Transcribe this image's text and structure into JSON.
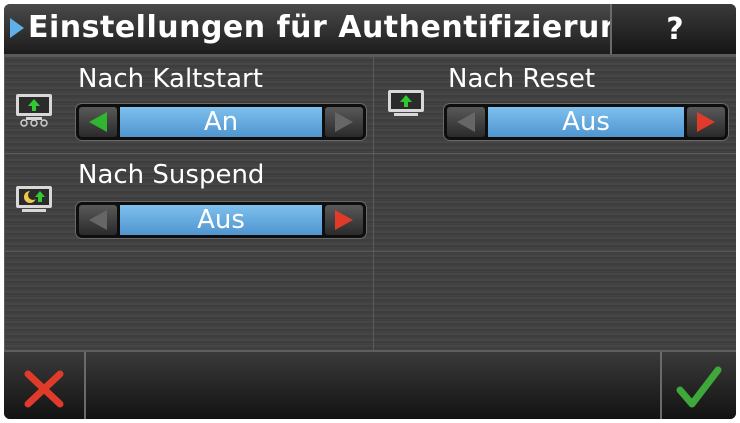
{
  "header": {
    "title": "Einstellungen für Authentifizierung",
    "help_label": "?"
  },
  "settings": [
    {
      "label": "Nach Kaltstart",
      "value": "An",
      "icon": "monitor-power-on-icon",
      "left_arrow_color": "#2fb52f",
      "right_arrow_color": "#666666"
    },
    {
      "label": "Nach Reset",
      "value": "Aus",
      "icon": "monitor-reset-icon",
      "left_arrow_color": "#666666",
      "right_arrow_color": "#e03a2a"
    },
    {
      "label": "Nach Suspend",
      "value": "Aus",
      "icon": "monitor-suspend-icon",
      "left_arrow_color": "#666666",
      "right_arrow_color": "#e03a2a"
    }
  ],
  "footer": {
    "cancel_icon": "red-x-cancel-icon",
    "confirm_icon": "green-checkmark-icon"
  },
  "colors": {
    "accent_blue": "#5fb0e8",
    "value_field": "#6aaee4",
    "cancel_red": "#e03a2a",
    "confirm_green": "#3fa83a"
  }
}
